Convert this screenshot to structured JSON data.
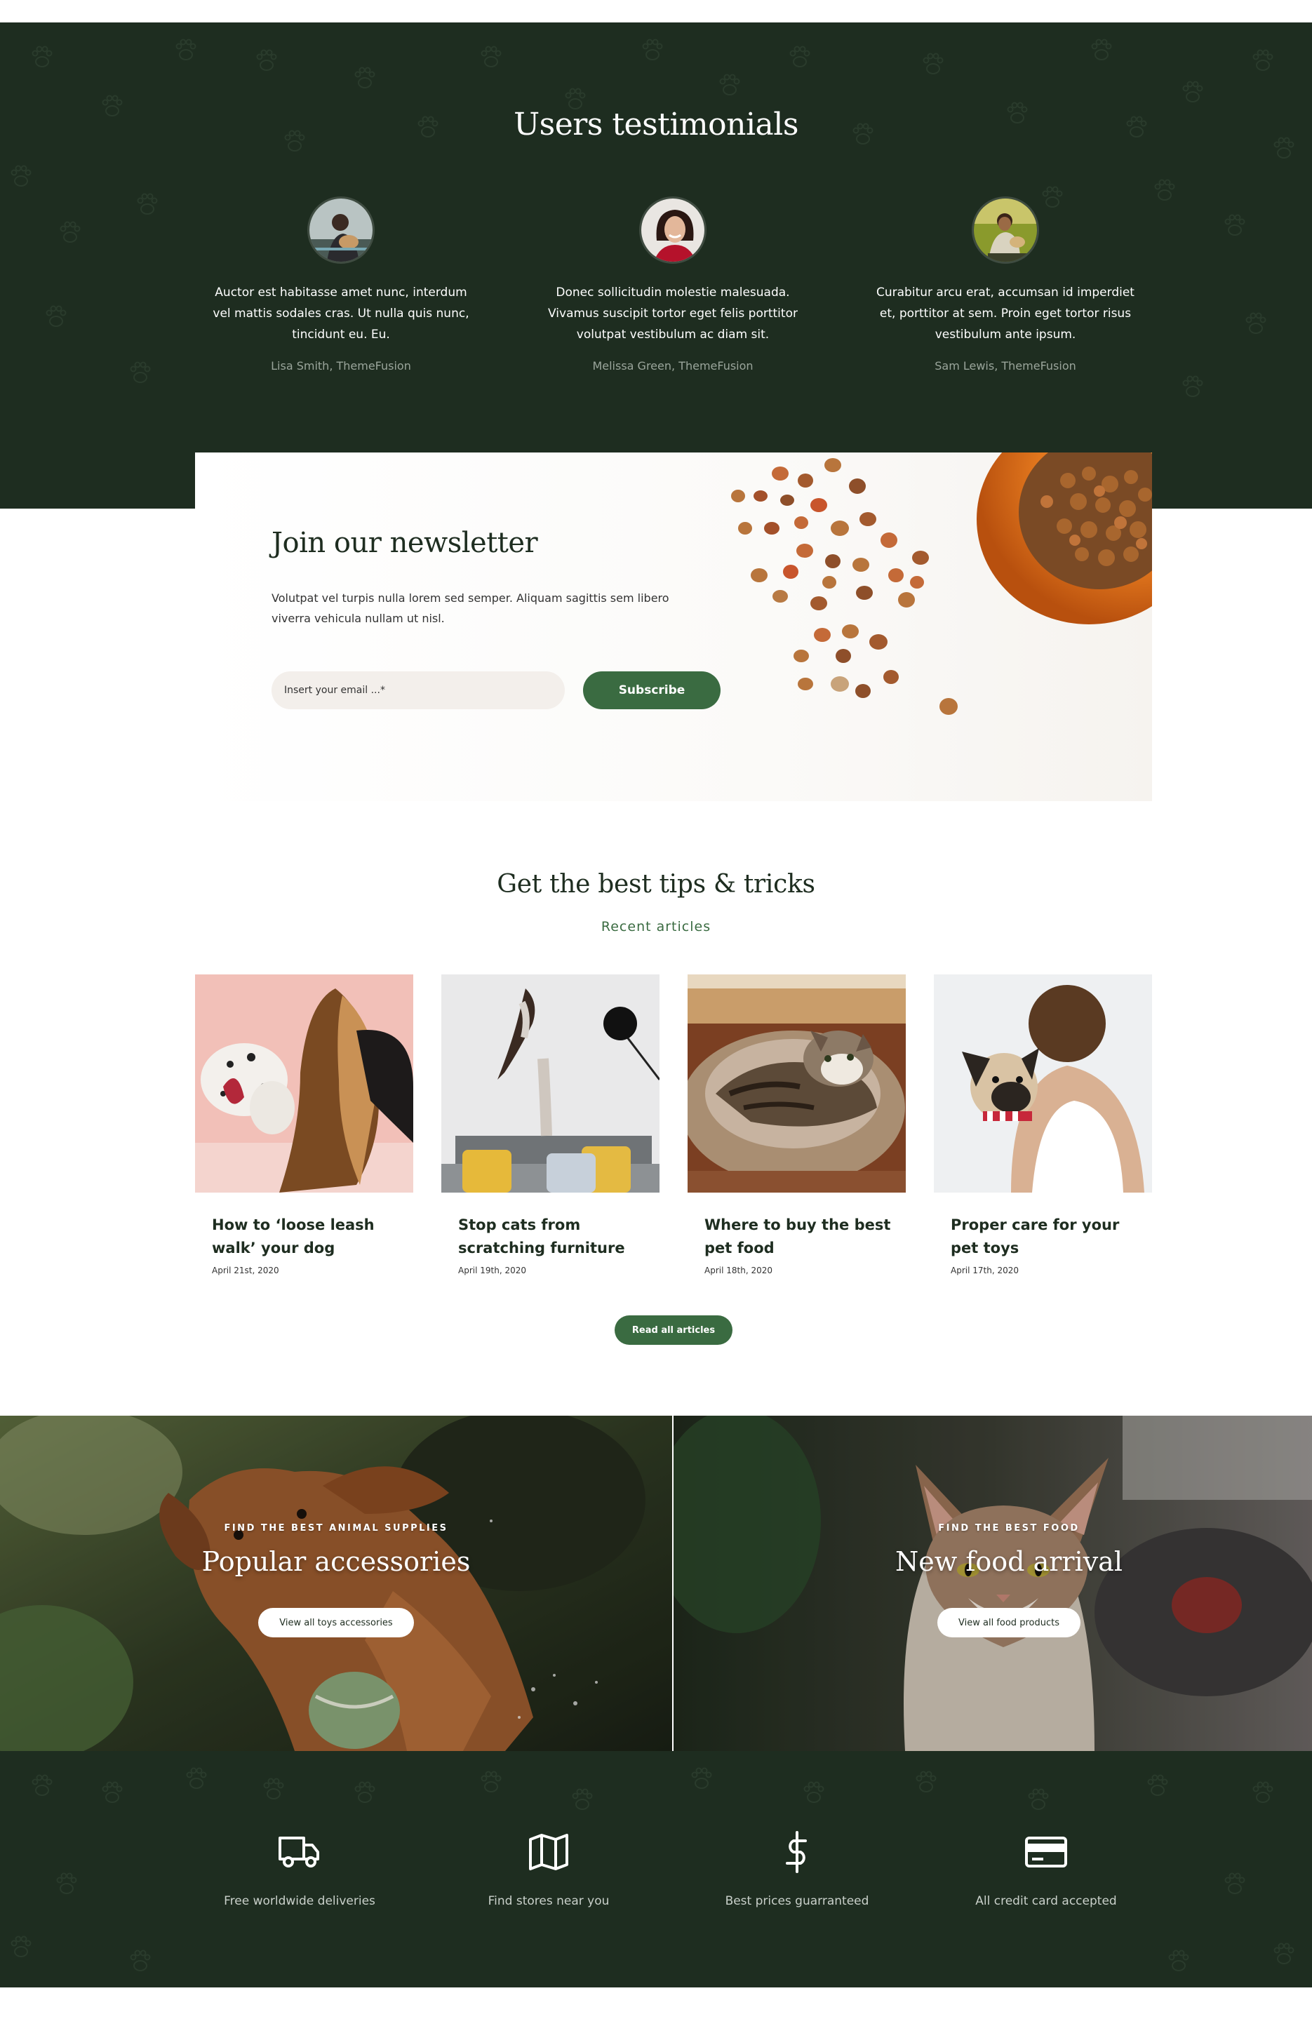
{
  "colors": {
    "dark_green": "#1e2d20",
    "accent_green": "#3a6b41",
    "muted_text": "#9aa59b",
    "white": "#ffffff"
  },
  "testimonials": {
    "title": "Users testimonials",
    "items": [
      {
        "quote": "Auctor est habitasse amet nunc, interdum vel mattis sodales cras. Ut nulla quis nunc, tincidunt eu. Eu.",
        "author": "Lisa Smith, ThemeFusion"
      },
      {
        "quote": "Donec sollicitudin molestie malesuada. Vivamus suscipit tortor eget felis porttitor volutpat vestibulum ac diam sit.",
        "author": "Melissa Green, ThemeFusion"
      },
      {
        "quote": "Curabitur arcu erat, accumsan id imperdiet et, porttitor at sem. Proin eget tortor risus vestibulum ante ipsum.",
        "author": "Sam Lewis, ThemeFusion"
      }
    ]
  },
  "newsletter": {
    "title": "Join our newsletter",
    "text": "Volutpat vel turpis nulla lorem sed semper. Aliquam sagittis sem libero viverra vehicula nullam ut nisl.",
    "email_placeholder": "Insert your email ...*",
    "subscribe_label": "Subscribe"
  },
  "blog": {
    "title": "Get the best tips & tricks",
    "subtitle": "Recent articles",
    "articles": [
      {
        "title": "How to ‘loose leash walk’ your dog",
        "date": "April 21st, 2020"
      },
      {
        "title": "Stop cats from scratching furniture",
        "date": "April 19th, 2020"
      },
      {
        "title": "Where to buy the best pet food",
        "date": "April 18th, 2020"
      },
      {
        "title": "Proper care for your pet toys",
        "date": "April 17th, 2020"
      }
    ],
    "read_all_label": "Read all articles"
  },
  "promos": [
    {
      "kicker": "FIND THE BEST ANIMAL SUPPLIES",
      "title": "Popular accessories",
      "button_label": "View all toys accessories"
    },
    {
      "kicker": "FIND THE BEST FOOD",
      "title": "New food arrival",
      "button_label": "View all food products"
    }
  ],
  "features": [
    {
      "icon": "truck-icon",
      "label": "Free worldwide deliveries"
    },
    {
      "icon": "map-icon",
      "label": "Find stores near you"
    },
    {
      "icon": "dollar-icon",
      "label": "Best prices guarranteed"
    },
    {
      "icon": "credit-card-icon",
      "label": "All credit card accepted"
    }
  ]
}
